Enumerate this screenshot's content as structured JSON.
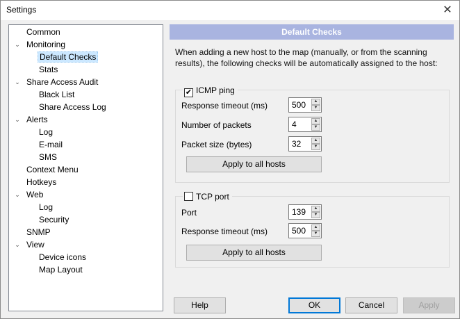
{
  "window": {
    "title": "Settings",
    "close_icon": "✕"
  },
  "tree": {
    "items": [
      {
        "label": "Common"
      },
      {
        "label": "Monitoring"
      },
      {
        "label": "Default Checks"
      },
      {
        "label": "Stats"
      },
      {
        "label": "Share Access Audit"
      },
      {
        "label": "Black List"
      },
      {
        "label": "Share Access Log"
      },
      {
        "label": "Alerts"
      },
      {
        "label": "Log"
      },
      {
        "label": "E-mail"
      },
      {
        "label": "SMS"
      },
      {
        "label": "Context Menu"
      },
      {
        "label": "Hotkeys"
      },
      {
        "label": "Web"
      },
      {
        "label": "Log"
      },
      {
        "label": "Security"
      },
      {
        "label": "SNMP"
      },
      {
        "label": "View"
      },
      {
        "label": "Device icons"
      },
      {
        "label": "Map Layout"
      }
    ],
    "selected": "Default Checks"
  },
  "panel": {
    "title": "Default Checks",
    "description": "When adding a new host to the map (manually, or from the scanning results), the following checks will be automatically assigned to the host:"
  },
  "icmp": {
    "label": "ICMP ping",
    "checked": true,
    "check_mark": "✔",
    "response_timeout_label": "Response timeout (ms)",
    "response_timeout": "500",
    "packets_label": "Number of packets",
    "packets": "4",
    "packet_size_label": "Packet size (bytes)",
    "packet_size": "32",
    "apply_label": "Apply to all hosts"
  },
  "tcp": {
    "label": "TCP port",
    "checked": false,
    "port_label": "Port",
    "port": "139",
    "response_timeout_label": "Response timeout (ms)",
    "response_timeout": "500",
    "apply_label": "Apply to all hosts"
  },
  "spinner": {
    "up": "▲",
    "down": "▼"
  },
  "tree_chevron": "⌄",
  "footer": {
    "help": "Help",
    "ok": "OK",
    "cancel": "Cancel",
    "apply": "Apply"
  }
}
